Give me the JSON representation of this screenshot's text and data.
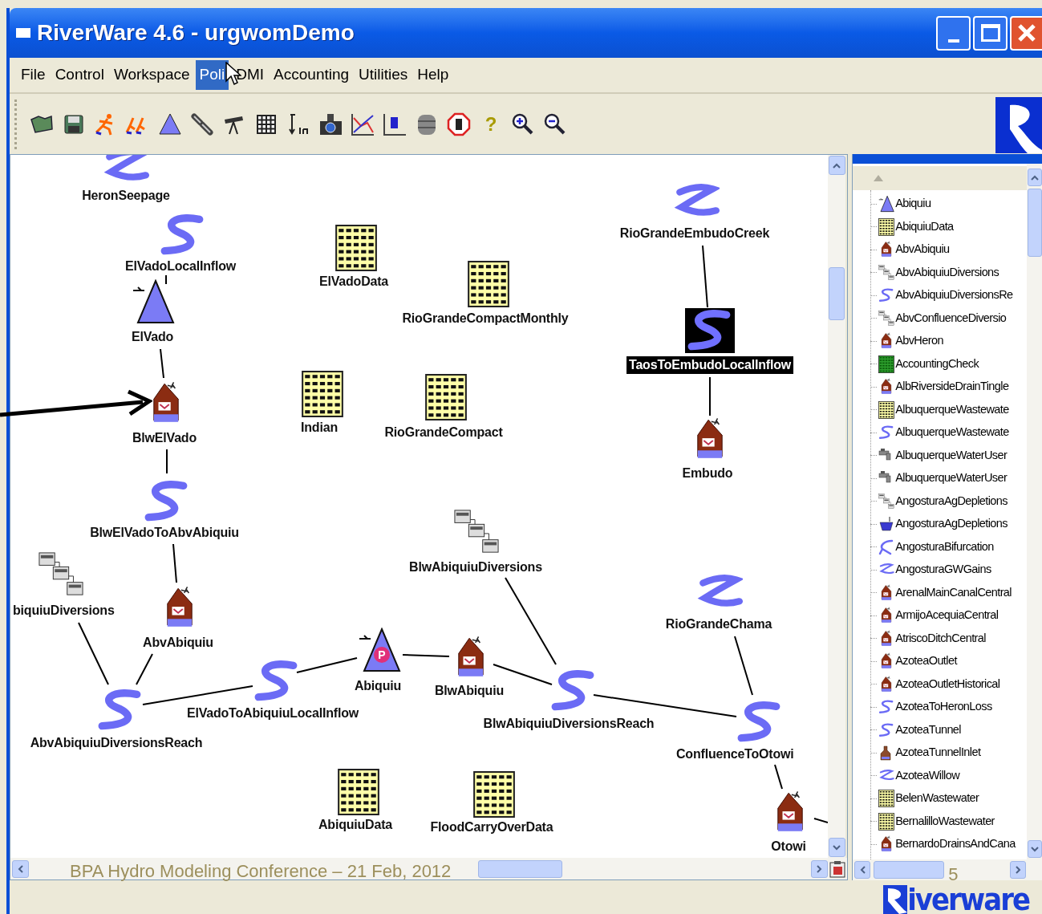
{
  "window": {
    "title": "RiverWare 4.6 - urgwomDemo"
  },
  "menu": [
    {
      "label": "File",
      "selected": false
    },
    {
      "label": "Control",
      "selected": false
    },
    {
      "label": "Workspace",
      "selected": false
    },
    {
      "label": "Poli",
      "selected": true
    },
    {
      "label": "DMI",
      "selected": false
    },
    {
      "label": "Accounting",
      "selected": false
    },
    {
      "label": "Utilities",
      "selected": false
    },
    {
      "label": "Help",
      "selected": false
    }
  ],
  "toolbar": {
    "help_glyph": "?"
  },
  "workspace": {
    "nodes": [
      {
        "kind": "inflow",
        "label": "HeronSeepage",
        "selected": false
      },
      {
        "kind": "reach",
        "label": "ElVadoLocalInflow",
        "selected": false
      },
      {
        "kind": "reservoir",
        "label": "ElVado",
        "selected": false
      },
      {
        "kind": "house",
        "label": "BlwElVado",
        "selected": false
      },
      {
        "kind": "reach",
        "label": "BlwElVadoToAbvAbiquiu",
        "selected": false
      },
      {
        "kind": "diversion",
        "label": "biquiuDiversions",
        "selected": false
      },
      {
        "kind": "house",
        "label": "AbvAbiquiu",
        "selected": false
      },
      {
        "kind": "reach",
        "label": "AbvAbiquiuDiversionsReach",
        "selected": false
      },
      {
        "kind": "reach",
        "label": "ElVadoToAbiquiuLocalInflow",
        "selected": false
      },
      {
        "kind": "reservoir",
        "label": "Abiquiu",
        "selected": false,
        "badge": "P"
      },
      {
        "kind": "diversion",
        "label": "BlwAbiquiuDiversions",
        "selected": false
      },
      {
        "kind": "house",
        "label": "BlwAbiquiu",
        "selected": false
      },
      {
        "kind": "reach",
        "label": "BlwAbiquiuDiversionsReach",
        "selected": false
      },
      {
        "kind": "inflow",
        "label": "RioGrandeChama",
        "selected": false
      },
      {
        "kind": "reach",
        "label": "ConfluenceToOtowi",
        "selected": false
      },
      {
        "kind": "house",
        "label": "Otowi",
        "selected": false
      },
      {
        "kind": "inflow",
        "label": "RioGrandeEmbudoCreek",
        "selected": false
      },
      {
        "kind": "reach",
        "label": "TaosToEmbudoLocalInflow",
        "selected": true
      },
      {
        "kind": "house",
        "label": "Embudo",
        "selected": false
      },
      {
        "kind": "data",
        "label": "ElVadoData",
        "selected": false
      },
      {
        "kind": "data",
        "label": "RioGrandeCompactMonthly",
        "selected": false
      },
      {
        "kind": "data",
        "label": "Indian",
        "selected": false
      },
      {
        "kind": "data",
        "label": "RioGrandeCompact",
        "selected": false
      },
      {
        "kind": "data",
        "label": "AbiquiuData",
        "selected": false
      },
      {
        "kind": "data",
        "label": "FloodCarryOverData",
        "selected": false
      }
    ]
  },
  "object_list": {
    "items": [
      {
        "kind": "reservoir",
        "label": "Abiquiu"
      },
      {
        "kind": "data",
        "label": "AbiquiuData"
      },
      {
        "kind": "house",
        "label": "AbvAbiquiu"
      },
      {
        "kind": "diversion",
        "label": "AbvAbiquiuDiversions"
      },
      {
        "kind": "reach",
        "label": "AbvAbiquiuDiversionsRe"
      },
      {
        "kind": "diversion",
        "label": "AbvConfluenceDiversio"
      },
      {
        "kind": "house",
        "label": "AbvHeron"
      },
      {
        "kind": "accounting",
        "label": "AccountingCheck"
      },
      {
        "kind": "house",
        "label": "AlbRiversideDrainTingle"
      },
      {
        "kind": "data",
        "label": "AlbuquerqueWastewate"
      },
      {
        "kind": "reach",
        "label": "AlbuquerqueWastewate"
      },
      {
        "kind": "wateruser",
        "label": "AlbuquerqueWaterUser"
      },
      {
        "kind": "wateruser",
        "label": "AlbuquerqueWaterUser"
      },
      {
        "kind": "diversion",
        "label": "AngosturaAgDepletions"
      },
      {
        "kind": "bowl",
        "label": "AngosturaAgDepletions"
      },
      {
        "kind": "bifurcation",
        "label": "AngosturaBifurcation"
      },
      {
        "kind": "inflow",
        "label": "AngosturaGWGains"
      },
      {
        "kind": "house",
        "label": "ArenalMainCanalCentral"
      },
      {
        "kind": "house",
        "label": "ArmijoAcequiaCentral"
      },
      {
        "kind": "house",
        "label": "AtriscoDitchCentral"
      },
      {
        "kind": "house",
        "label": "AzoteaOutlet"
      },
      {
        "kind": "house",
        "label": "AzoteaOutletHistorical"
      },
      {
        "kind": "reach",
        "label": "AzoteaToHeronLoss"
      },
      {
        "kind": "reach",
        "label": "AzoteaTunnel"
      },
      {
        "kind": "inlet",
        "label": "AzoteaTunnelInlet"
      },
      {
        "kind": "inflow",
        "label": "AzoteaWillow"
      },
      {
        "kind": "data",
        "label": "BelenWastewater"
      },
      {
        "kind": "data",
        "label": "BernalilloWastewater"
      },
      {
        "kind": "house",
        "label": "BernardoDrainsAndCana"
      }
    ]
  },
  "slide": {
    "footer": "BPA Hydro Modeling Conference – 21 Feb, 2012",
    "page_number": "5",
    "logo_text": "iverware"
  }
}
